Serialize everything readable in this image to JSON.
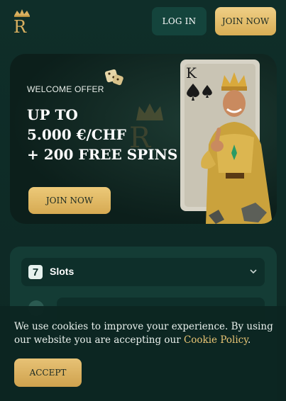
{
  "header": {
    "logo_letter": "R",
    "login_label": "LOG IN",
    "join_label": "JOIN NOW"
  },
  "hero": {
    "eyebrow": "WELCOME OFFER",
    "line1": "UP TO",
    "line2": "5.000 €/CHF",
    "line3": "+ 200 FREE SPINS",
    "cta_label": "JOIN NOW",
    "card_rank": "K"
  },
  "categories": {
    "slots_label": "Slots",
    "slots_icon_glyph": "7"
  },
  "cookie": {
    "text": "We use cookies to improve your experience. By using our website you are accepting our ",
    "link_text": "Cookie Policy",
    "suffix": ".",
    "accept_label": "ACCEPT"
  },
  "colors": {
    "background": "#0e2b26",
    "gold": "#e2bb6a",
    "panel": "#143c35",
    "login_button": "#14443c"
  }
}
